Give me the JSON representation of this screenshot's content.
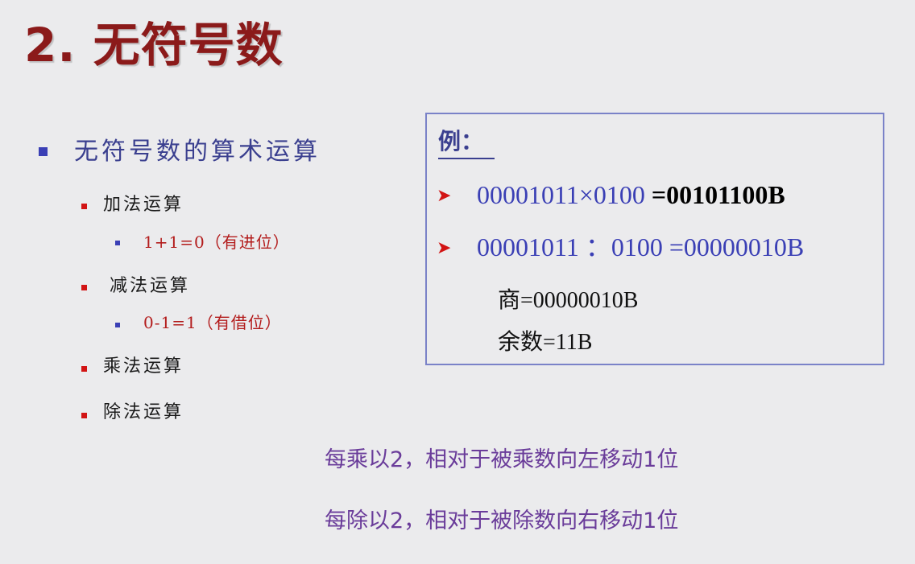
{
  "title": "2. 无符号数",
  "section": {
    "heading": "无符号数的算术运算",
    "items": [
      {
        "label": "加法运算",
        "sub": "1+1=0（有进位）"
      },
      {
        "label": "减法运算",
        "sub": "0-1=1（有借位）"
      },
      {
        "label": "乘法运算"
      },
      {
        "label": "除法运算"
      }
    ]
  },
  "example": {
    "label": "例：",
    "mul": {
      "lhs": "00001011×0100 ",
      "result": "=00101100B"
    },
    "div": {
      "expr": "00001011 ：0100 =00000010B"
    },
    "quotient": "商=00000010B",
    "remainder": "余数=11B"
  },
  "notes": [
    "每乘以2，相对于被乘数向左移动1位",
    "每除以2，相对于被除数向右移动1位"
  ],
  "colors": {
    "title": "#8b1a1a",
    "heading": "#3a3f8f",
    "bullet_l1": "#3a3fb5",
    "bullet_l2": "#d21414",
    "sub_text": "#b31c1c",
    "notes": "#6a3c9a",
    "box_border": "#7a82c8"
  }
}
